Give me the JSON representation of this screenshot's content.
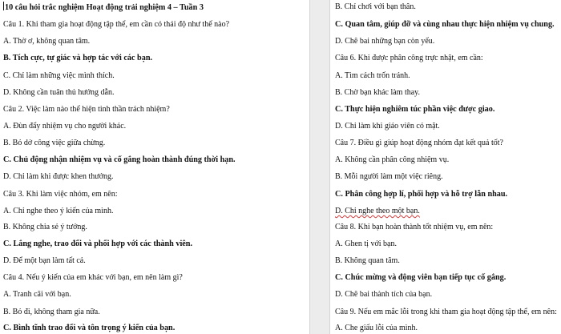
{
  "left": {
    "lines": [
      {
        "text": "10 câu hỏi trắc nghiệm Hoạt động trải nghiệm 4 – Tuần 3",
        "bold": true
      },
      {
        "text": "Câu 1. Khi tham gia hoạt động tập thể, em cần có thái độ như thế nào?",
        "bold": false
      },
      {
        "text": "A. Thờ ơ, không quan tâm.",
        "bold": false
      },
      {
        "text": "B. Tích cực, tự giác và hợp tác với các bạn.",
        "bold": true
      },
      {
        "text": "C. Chỉ làm những việc mình thích.",
        "bold": false
      },
      {
        "text": "D. Không cần tuân thủ hướng dẫn.",
        "bold": false
      },
      {
        "text": "Câu 2. Việc làm nào thể hiện tinh thần trách nhiệm?",
        "bold": false
      },
      {
        "text": "A. Đùn đẩy nhiệm vụ cho người khác.",
        "bold": false
      },
      {
        "text": "B. Bỏ dở công việc giữa chừng.",
        "bold": false
      },
      {
        "text": "C. Chủ động nhận nhiệm vụ và cố gắng hoàn thành đúng thời hạn.",
        "bold": true
      },
      {
        "text": "D. Chỉ làm khi được khen thưởng.",
        "bold": false
      },
      {
        "text": "Câu 3. Khi làm việc nhóm, em nên:",
        "bold": false
      },
      {
        "text": "A. Chỉ nghe theo ý kiến của mình.",
        "bold": false
      },
      {
        "text": "B. Không chia sẻ ý tưởng.",
        "bold": false
      },
      {
        "text": "C. Lắng nghe, trao đổi và phối hợp với các thành viên.",
        "bold": true
      },
      {
        "text": "D. Để một bạn làm tất cả.",
        "bold": false
      },
      {
        "text": "Câu 4. Nếu ý kiến của em khác với bạn, em nên làm gì?",
        "bold": false
      },
      {
        "text": "A. Tranh cãi với bạn.",
        "bold": false
      },
      {
        "text": "B. Bỏ đi, không tham gia nữa.",
        "bold": false
      },
      {
        "text": "C. Bình tĩnh trao đổi và tôn trọng ý kiến của bạn.",
        "bold": true
      }
    ]
  },
  "right": {
    "lines": [
      {
        "text": "B. Chỉ chơi với bạn thân.",
        "bold": false
      },
      {
        "text": "C. Quan tâm, giúp đỡ và cùng nhau thực hiện nhiệm vụ chung.",
        "bold": true
      },
      {
        "text": "D. Chê bai những bạn còn yếu.",
        "bold": false
      },
      {
        "text": "Câu 6. Khi được phân công trực nhật, em cần:",
        "bold": false
      },
      {
        "text": "A. Tìm cách trốn tránh.",
        "bold": false
      },
      {
        "text": "B. Chờ bạn khác làm thay.",
        "bold": false
      },
      {
        "text": "C. Thực hiện nghiêm túc phần việc được giao.",
        "bold": true
      },
      {
        "text": "D. Chỉ làm khi giáo viên có mặt.",
        "bold": false
      },
      {
        "text": "Câu 7. Điều gì giúp hoạt động nhóm đạt kết quả tốt?",
        "bold": false
      },
      {
        "text": "A. Không cần phân công nhiệm vụ.",
        "bold": false
      },
      {
        "text": "B. Mỗi người làm một việc riêng.",
        "bold": false
      },
      {
        "text": "C. Phân công hợp lí, phối hợp và hỗ trợ lẫn nhau.",
        "bold": true
      },
      {
        "text": "D. Chỉ nghe theo một bạn.",
        "bold": false
      },
      {
        "text": "Câu 8. Khi bạn hoàn thành tốt nhiệm vụ, em nên:",
        "bold": false
      },
      {
        "text": "A. Ghen tị với bạn.",
        "bold": false
      },
      {
        "text": "B. Không quan tâm.",
        "bold": false
      },
      {
        "text": "C. Chúc mừng và động viên bạn tiếp tục cố gắng.",
        "bold": true
      },
      {
        "text": "D. Chê bai thành tích của bạn.",
        "bold": false
      },
      {
        "text": "Câu 9. Nếu em mắc lỗi trong khi tham gia hoạt động tập thể, em nên:",
        "bold": false
      },
      {
        "text": "A. Che giấu lỗi của mình.",
        "bold": false
      }
    ]
  }
}
